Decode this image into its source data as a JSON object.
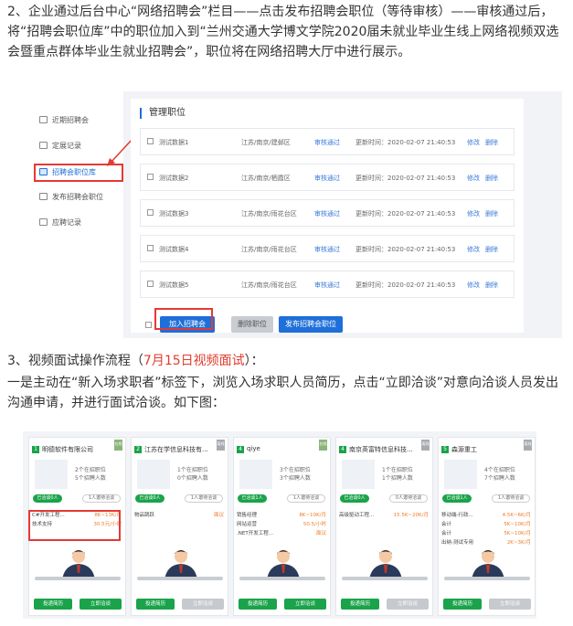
{
  "paragraph1": "2、企业通过后台中心“网络招聘会”栏目——点击发布招聘会职位（等待审核）——审核通过后，将“招聘会职位库”中的职位加入到“兰州交通大学博文学院2020届未就业毕业生线上网络视频双选会暨重点群体毕业生就业招聘会”，职位将在网络招聘大厅中进行展示。",
  "paragraph2": {
    "prefix": "3、视频面试操作流程（",
    "highlight": "7月15日视频面试",
    "suffix": "）："
  },
  "paragraph3": "一是主动在“新入场求职者”标签下，浏览入场求职人员简历，点击“立即洽谈”对意向洽谈人员发出沟通申请，并进行面试洽谈。如下图：",
  "admin": {
    "sidebar": [
      "近期招聘会",
      "定展记录",
      "招聘会职位库",
      "发布招聘会职位",
      "应聘记录"
    ],
    "title": "管理职位",
    "rows": [
      {
        "name": "测试数据1",
        "location": "江苏/南京/建邺区",
        "status": "审核通过",
        "time": "更新时间：2020-02-07 21:40:53",
        "edit": "修改",
        "del": "删除"
      },
      {
        "name": "测试数据2",
        "location": "江苏/南京/栖霞区",
        "status": "审核通过",
        "time": "更新时间：2020-02-07 21:40:53",
        "edit": "修改",
        "del": "删除"
      },
      {
        "name": "测试数据3",
        "location": "江苏/南京/雨花台区",
        "status": "审核通过",
        "time": "更新时间：2020-02-07 21:40:53",
        "edit": "修改",
        "del": "删除"
      },
      {
        "name": "测试数据4",
        "location": "江苏/南京/雨花台区",
        "status": "审核通过",
        "time": "更新时间：2020-02-07 21:40:53",
        "edit": "修改",
        "del": "删除"
      },
      {
        "name": "测试数据5",
        "location": "江苏/南京/雨花台区",
        "status": "审核通过",
        "time": "更新时间：2020-02-07 21:40:53",
        "edit": "修改",
        "del": "删除"
      }
    ],
    "buttons": {
      "add": "加入招聘会",
      "remove": "删除职位",
      "publish": "发布招聘会职位"
    }
  },
  "cards": [
    {
      "num": "1",
      "company": "明德软件有限公司",
      "tag": "在线",
      "tag_grey": false,
      "line1": "2个在招职位",
      "line2": "5个招聘人数",
      "pill1": "已洽谈0人",
      "pill2": "1人邀待洽谈",
      "jobs": [
        {
          "n": "C#开发工程...",
          "s": "8K~13K/月"
        },
        {
          "n": "技术支持",
          "s": "30.5元/小时"
        }
      ],
      "btn1": "投递简历",
      "btn2": "立即洽谈",
      "btn2_grey": false
    },
    {
      "num": "2",
      "company": "江苏在学信息科技有...",
      "tag": "离线",
      "tag_grey": true,
      "line1": "1个在招职位",
      "line2": "0个招聘人数",
      "pill1": "已洽谈0人",
      "pill2": "1人邀待洽谈",
      "jobs": [
        {
          "n": "物品跳跃",
          "s": "面议"
        }
      ],
      "btn1": "投递简历",
      "btn2": "立即洽谈",
      "btn2_grey": true
    },
    {
      "num": "4",
      "company": "qiye",
      "tag": "在线",
      "tag_grey": false,
      "line1": "3个在招职位",
      "line2": "3个招聘人数",
      "pill1": "已洽谈1人",
      "pill2": "1人邀待洽谈",
      "jobs": [
        {
          "n": "销售经理",
          "s": "8K~10K/月"
        },
        {
          "n": "网站运营",
          "s": "50.5/小时"
        },
        {
          "n": ".NET开发工程...",
          "s": "面议"
        }
      ],
      "btn1": "投递简历",
      "btn2": "立即洽谈",
      "btn2_grey": false
    },
    {
      "num": "4",
      "company": "南京英富特信息科技...",
      "tag": "离线",
      "tag_grey": true,
      "line1": "1个在招职位",
      "line2": "1个招聘人数",
      "pill1": "已洽谈0人",
      "pill2": "0人邀待洽谈",
      "jobs": [
        {
          "n": "高级驱动工程...",
          "s": "15.5K~20K/月"
        }
      ],
      "btn1": "投递简历",
      "btn2": "立即洽谈",
      "btn2_grey": true
    },
    {
      "num": "5",
      "company": "森源重工",
      "tag": "离线",
      "tag_grey": true,
      "line1": "4个在招职位",
      "line2": "7个招聘人数",
      "pill1": "已洽谈1人",
      "pill2": "1人邀待洽谈",
      "jobs": [
        {
          "n": "移动端-行政...",
          "s": "4.5K~6K/月"
        },
        {
          "n": "会计",
          "s": "5K~10K/月"
        },
        {
          "n": "会计",
          "s": "5K~10K/月"
        },
        {
          "n": "出纳-测试专用",
          "s": "2K~3K/月"
        }
      ],
      "btn1": "投递简历",
      "btn2": "立即洽谈",
      "btn2_grey": true
    }
  ],
  "colors": {
    "accent_blue": "#1e6fd9",
    "green": "#1aa34a",
    "red": "#e53935",
    "orange": "#f07c2a"
  }
}
